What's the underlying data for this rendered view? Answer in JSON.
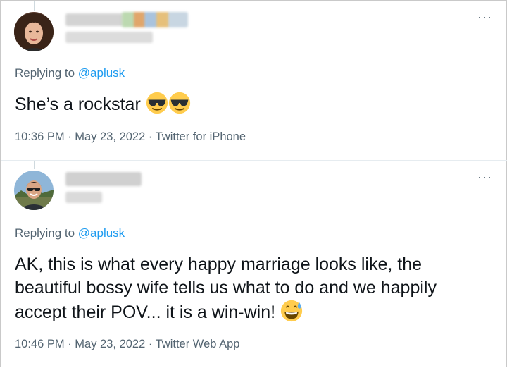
{
  "tweets": [
    {
      "replying_prefix": "Replying to ",
      "replying_handle": "@aplusk",
      "text": "She’s a rockstar",
      "emojis": [
        "sunglasses-emoji",
        "sunglasses-emoji"
      ],
      "meta": "10:36 PM · May 23, 2022 · Twitter for iPhone",
      "more": "···"
    },
    {
      "replying_prefix": "Replying to ",
      "replying_handle": "@aplusk",
      "text": "AK, this is what every happy marriage looks like, the beautiful bossy wife tells us what to do and we happily accept their POV... it is a win-win!",
      "emojis": [
        "grinning-sweat-emoji"
      ],
      "meta": "10:46 PM · May 23, 2022 · Twitter Web App",
      "more": "···"
    }
  ],
  "colors": {
    "link": "#1d9bf0",
    "secondary_text": "#536471",
    "primary_text": "#0f1419",
    "divider": "#e6ecf0"
  }
}
